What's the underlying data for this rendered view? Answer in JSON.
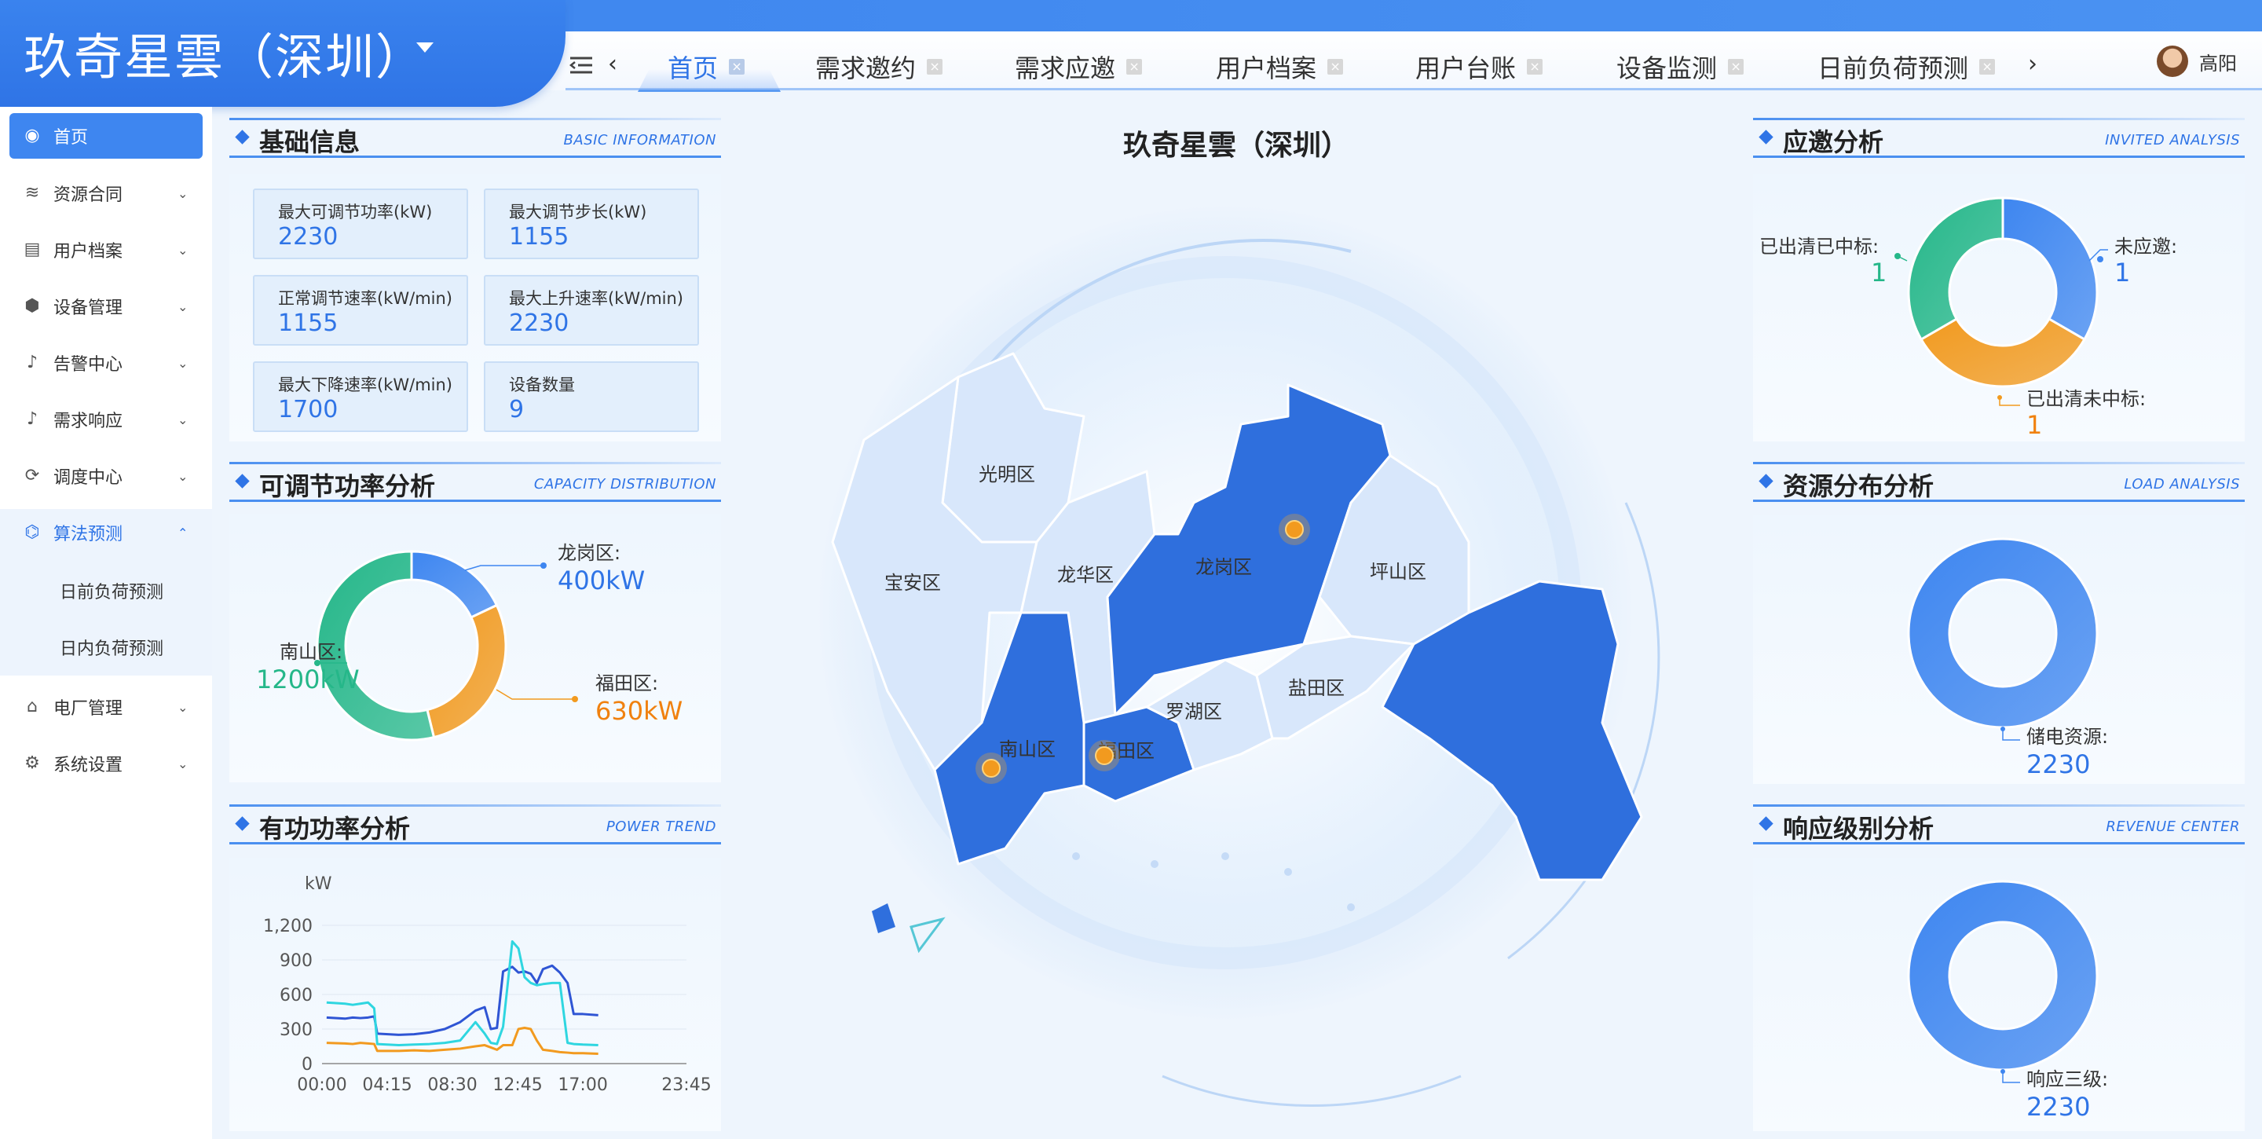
{
  "app": {
    "brand": "玖奇星雲（深圳）",
    "map_title": "玖奇星雲（深圳）"
  },
  "tabs": [
    {
      "label": "首页",
      "active": true
    },
    {
      "label": "需求邀约"
    },
    {
      "label": "需求应邀"
    },
    {
      "label": "用户档案"
    },
    {
      "label": "用户台账"
    },
    {
      "label": "设备监测"
    },
    {
      "label": "日前负荷预测"
    }
  ],
  "tab_close_glyph": "×",
  "user": {
    "name": "高阳"
  },
  "sidebar": {
    "items": [
      {
        "label": "首页",
        "icon": "dashboard-icon"
      },
      {
        "label": "资源合同",
        "icon": "layers-icon"
      },
      {
        "label": "用户档案",
        "icon": "user-card-icon"
      },
      {
        "label": "设备管理",
        "icon": "box-icon"
      },
      {
        "label": "告警中心",
        "icon": "bell-icon"
      },
      {
        "label": "需求响应",
        "icon": "bell-icon"
      },
      {
        "label": "调度中心",
        "icon": "refresh-box-icon"
      },
      {
        "label": "算法预测",
        "icon": "algorithm-icon",
        "expanded": true
      },
      {
        "label": "电厂管理",
        "icon": "house-icon"
      },
      {
        "label": "系统设置",
        "icon": "gear-icon"
      }
    ],
    "subitems": [
      "日前负荷预测",
      "日内负荷预测"
    ]
  },
  "basic_info": {
    "title": "基础信息",
    "subtitle": "BASIC INFORMATION",
    "cards": [
      {
        "label": "最大可调节功率(kW)",
        "value": "2230"
      },
      {
        "label": "最大调节步长(kW)",
        "value": "1155"
      },
      {
        "label": "正常调节速率(kW/min)",
        "value": "1155"
      },
      {
        "label": "最大上升速率(kW/min)",
        "value": "2230"
      },
      {
        "label": "最大下降速率(kW/min)",
        "value": "1700"
      },
      {
        "label": "设备数量",
        "value": "9"
      }
    ]
  },
  "capacity": {
    "title": "可调节功率分析",
    "subtitle": "CAPACITY DISTRIBUTION",
    "labels": {
      "longgang": "龙岗区:",
      "longgang_v": "400kW",
      "futian": "福田区:",
      "futian_v": "630kW",
      "nanshan": "南山区:",
      "nanshan_v": "1200kW"
    }
  },
  "power": {
    "title": "有功功率分析",
    "subtitle": "POWER TREND",
    "unit": "kW"
  },
  "invited": {
    "title": "应邀分析",
    "subtitle": "INVITED ANALYSIS",
    "labels": {
      "won": "已出清已中标:",
      "won_v": "1",
      "none": "未应邀:",
      "none_v": "1",
      "lost": "已出清未中标:",
      "lost_v": "1"
    }
  },
  "load": {
    "title": "资源分布分析",
    "subtitle": "LOAD ANALYSIS",
    "labels": {
      "storage": "储电资源:",
      "storage_v": "2230"
    }
  },
  "revenue": {
    "title": "响应级别分析",
    "subtitle": "REVENUE CENTER",
    "labels": {
      "level3": "响应三级:",
      "level3_v": "2230"
    }
  },
  "map": {
    "districts": [
      "光明区",
      "宝安区",
      "龙华区",
      "龙岗区",
      "坪山区",
      "南山区",
      "福田区",
      "罗湖区",
      "盐田区"
    ]
  },
  "colors": {
    "accent": "#2f74e6",
    "green": "#25b789",
    "orange": "#f29a1f",
    "blue": "#3e86f0",
    "cyan": "#2fd6e0"
  },
  "chart_data": [
    {
      "type": "pie",
      "title": "可调节功率分析",
      "donut": true,
      "categories": [
        "龙岗区",
        "福田区",
        "南山区"
      ],
      "values": [
        400,
        630,
        1200
      ],
      "unit": "kW",
      "colors": [
        "#3e86f0",
        "#f29a1f",
        "#25b789"
      ]
    },
    {
      "type": "line",
      "title": "有功功率分析",
      "ylabel": "kW",
      "xticks": [
        "00:00",
        "04:15",
        "08:30",
        "12:45",
        "17:00",
        "23:45"
      ],
      "yticks": [
        "0",
        "300",
        "600",
        "900",
        "1,200"
      ],
      "ylim": [
        0,
        1200
      ],
      "xlim_hours": [
        0,
        23.75
      ],
      "grid": true,
      "series": [
        {
          "color": "#2f55d4",
          "x": [
            0.3,
            1.5,
            2,
            2.5,
            3,
            3.4,
            3.6,
            5,
            6,
            7,
            8,
            9,
            10,
            10.6,
            11,
            11.4,
            11.8,
            12.4,
            12.8,
            13.2,
            13.6,
            14,
            14.4,
            15,
            15.5,
            16,
            16.4,
            17,
            18
          ],
          "y": [
            400,
            390,
            400,
            395,
            400,
            410,
            260,
            250,
            255,
            270,
            300,
            360,
            460,
            490,
            300,
            310,
            800,
            840,
            790,
            800,
            780,
            700,
            820,
            850,
            790,
            700,
            430,
            430,
            420
          ]
        },
        {
          "color": "#2fd6e0",
          "x": [
            0.3,
            1.5,
            2,
            2.5,
            3,
            3.4,
            3.6,
            5,
            6,
            7,
            8,
            9,
            10,
            10.6,
            11,
            11.4,
            11.8,
            12.4,
            12.8,
            13.2,
            13.6,
            14,
            14.4,
            15,
            15.5,
            16,
            16.4,
            17,
            18
          ],
          "y": [
            530,
            520,
            510,
            520,
            530,
            480,
            170,
            160,
            165,
            170,
            180,
            200,
            360,
            260,
            180,
            170,
            320,
            1060,
            1000,
            750,
            700,
            680,
            690,
            700,
            700,
            180,
            170,
            165,
            160
          ]
        },
        {
          "color": "#f29a1f",
          "x": [
            0.3,
            1.5,
            2,
            2.5,
            3,
            3.4,
            3.6,
            5,
            6,
            7,
            8,
            9,
            10,
            10.6,
            11,
            11.4,
            11.8,
            12.4,
            12.8,
            13.2,
            13.6,
            14,
            14.4,
            15,
            15.5,
            16,
            16.4,
            17,
            18
          ],
          "y": [
            180,
            175,
            170,
            180,
            175,
            170,
            110,
            110,
            115,
            110,
            120,
            130,
            150,
            160,
            140,
            120,
            160,
            160,
            300,
            310,
            300,
            200,
            120,
            110,
            100,
            95,
            90,
            90,
            85
          ]
        }
      ]
    },
    {
      "type": "pie",
      "title": "应邀分析",
      "donut": true,
      "categories": [
        "未应邀",
        "已出清未中标",
        "已出清已中标"
      ],
      "values": [
        1,
        1,
        1
      ],
      "colors": [
        "#3e86f0",
        "#f29a1f",
        "#25b789"
      ]
    },
    {
      "type": "pie",
      "title": "资源分布分析",
      "donut": true,
      "categories": [
        "储电资源"
      ],
      "values": [
        2230
      ],
      "colors": [
        "#3e86f0"
      ]
    },
    {
      "type": "pie",
      "title": "响应级别分析",
      "donut": true,
      "categories": [
        "响应三级"
      ],
      "values": [
        2230
      ],
      "colors": [
        "#3e86f0"
      ]
    }
  ]
}
